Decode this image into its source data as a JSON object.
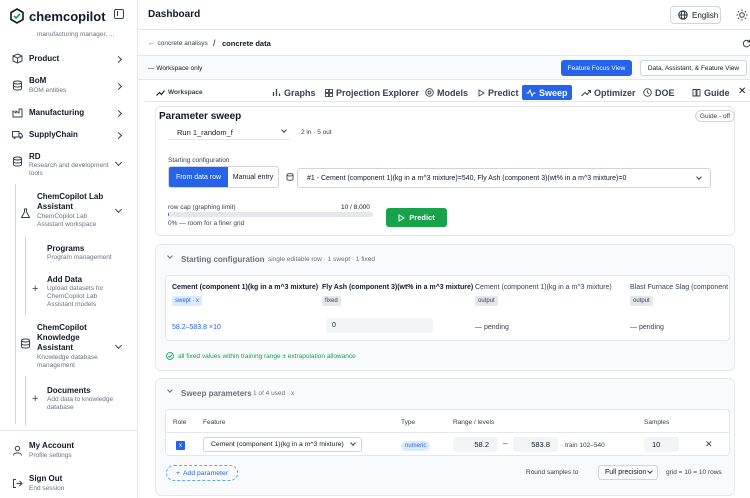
{
  "app": {
    "logo_text": "chemcopilot"
  },
  "sidebar": {
    "cut_text": "manufacturing manager, ...",
    "items": [
      {
        "label": "Product"
      },
      {
        "label": "BoM",
        "sub": "BOM entities"
      },
      {
        "label": "Manufacturing"
      },
      {
        "label": "SupplyChain"
      },
      {
        "label": "RD",
        "sub": "Research and development tools"
      }
    ],
    "rd_children": [
      {
        "label": "ChemCopilot Lab Assistant",
        "sub": "ChemCopilot Lab Assistant workspace"
      },
      {
        "label": "Programs",
        "sub": "Program management"
      },
      {
        "label": "Add Data",
        "sub": "Upload datasets for ChemCopilot Lab Assistant models"
      },
      {
        "label": "ChemCopilot Knowledge Assistant",
        "sub": "Knowledge database management"
      },
      {
        "label": "Documents",
        "sub": "Add data to knowledge database"
      }
    ],
    "account": {
      "label": "My Account",
      "sub": "Profile settings"
    },
    "signout": {
      "label": "Sign Out",
      "sub": "End session"
    }
  },
  "header": {
    "title": "Dashboard",
    "language": "English"
  },
  "breadcrumb": {
    "back": "concrete analisys",
    "separator": "/",
    "current": "concrete data"
  },
  "workspace": {
    "scope": "— Workspace only",
    "focus_view": "Feature Focus View",
    "full_view": "Data, Assistant, & Feature View"
  },
  "tabs": [
    "Workspace",
    "Graphs",
    "Projection Explorer",
    "Models",
    "Predict",
    "Sweep",
    "Optimizer",
    "DOE",
    "Guide"
  ],
  "tabs_active": "Sweep",
  "sweep": {
    "title": "Parameter sweep",
    "guide_toggle": "Guide - off",
    "run": "Run 1_random_f",
    "run_meta": "2 in · 5 out",
    "start_label": "Starting configuration",
    "from_row": "From data row",
    "manual": "Manual entry",
    "row_option": "#1 - Cement (component 1)(kg in a m^3 mixture)=540, Fly Ash (component 3)(wt% in a m^3 mixture)=0",
    "row_cap_label": "row cap (graphing limit)",
    "row_cap_value": "10 / 8,000",
    "row_cap_fraction": 0.00125,
    "room_note": "0% — room for a finer grid",
    "predict": "Predict"
  },
  "starting": {
    "title": "Starting configuration",
    "meta": "single editable row · 1 swept · 1 fixed",
    "columns": [
      {
        "name": "Cement (component 1)(kg in a m^3 mixture)",
        "role": "swept · x",
        "value": "58.2–583.8 ×10"
      },
      {
        "name": "Fly Ash (component 3)(wt% in a m^3 mixture)",
        "role": "fixed",
        "value": "0"
      },
      {
        "name": "Cement (component 1)(kg in a m^3 mixture)",
        "role": "output",
        "value": "— pending"
      },
      {
        "name": "Blast Furnace Slag (component",
        "role": "output",
        "value": "— pending"
      }
    ],
    "ok_note": "all fixed values within training range ± extrapolation allowance"
  },
  "sweep_params": {
    "title": "Sweep parameters",
    "meta": "1 of 4 used · x",
    "headers": {
      "role": "Role",
      "feature": "Feature",
      "type": "Type",
      "range": "Range / levels",
      "samples": "Samples"
    },
    "row": {
      "role": "x",
      "feature": "Cement (component 1)(kg in a m^3 mixture)",
      "type": "numeric",
      "min": "58.2",
      "max": "583.8",
      "train": "· train 102–540",
      "samples": "10"
    },
    "add": "Add parameter",
    "round_label": "Round samples to",
    "precision": "Full precision",
    "grid_summary": "grid = 10 = 10 rows"
  },
  "colors": {
    "accent": "#2563eb",
    "success": "#16a34a",
    "border": "#e5e7eb"
  }
}
